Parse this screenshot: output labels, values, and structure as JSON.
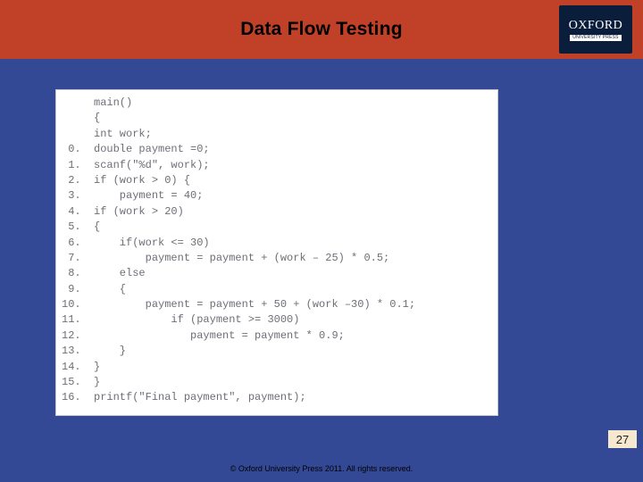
{
  "header": {
    "title": "Data Flow Testing",
    "logo_main": "OXFORD",
    "logo_sub": "UNIVERSITY PRESS"
  },
  "code": "     main()\n     {\n     int work;\n 0.  double payment =0;\n 1.  scanf(\"%d\", work);\n 2.  if (work > 0) {\n 3.      payment = 40;\n 4.  if (work > 20)\n 5.  {\n 6.      if(work <= 30)\n 7.          payment = payment + (work – 25) * 0.5;\n 8.      else\n 9.      {\n10.          payment = payment + 50 + (work –30) * 0.1;\n11.              if (payment >= 3000)\n12.                 payment = payment * 0.9;\n13.      }\n14.  }\n15.  }\n16.  printf(\"Final payment\", payment);",
  "footer": {
    "page_number": "27",
    "copyright": "© Oxford University Press 2011. All rights reserved."
  }
}
